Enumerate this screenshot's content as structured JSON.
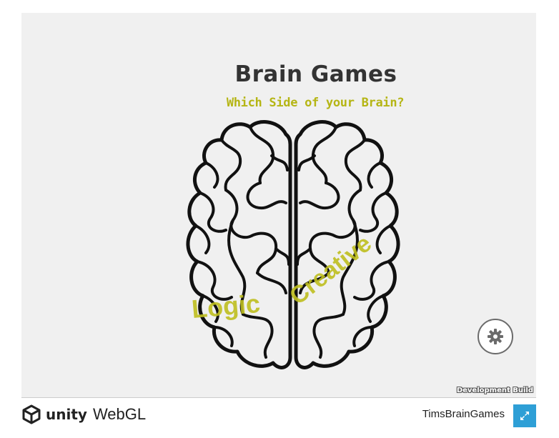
{
  "game": {
    "title": "Brain Games",
    "subtitle": "Which Side of your Brain?",
    "left_label": "Logic",
    "right_label": "Creative",
    "settings_icon": "gear-icon",
    "dev_build_label": "Development Build"
  },
  "footer": {
    "logo_unity": "unity",
    "logo_webgl": "WebGL",
    "game_name": "TimsBrainGames",
    "fullscreen_icon": "fullscreen-icon"
  },
  "colors": {
    "canvas_bg": "#f0f0f0",
    "title": "#333333",
    "accent_yellow": "#bfbf1f",
    "fullscreen_bg": "#2e9fd6"
  }
}
